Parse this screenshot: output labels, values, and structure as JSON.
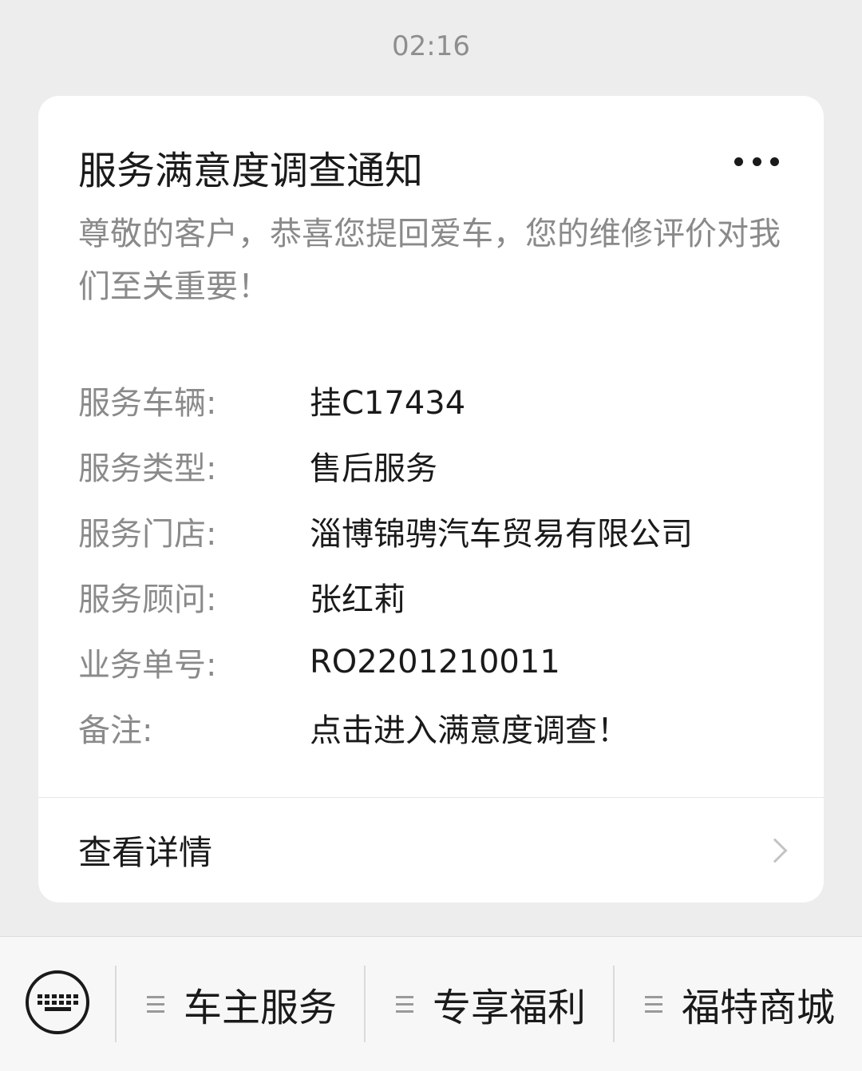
{
  "time": "02:16",
  "card": {
    "title": "服务满意度调查通知",
    "description": "尊敬的客户，恭喜您提回爱车，您的维修评价对我们至关重要！",
    "rows": [
      {
        "key": "服务车辆:",
        "value": "挂C17434"
      },
      {
        "key": "服务类型:",
        "value": "售后服务"
      },
      {
        "key": "服务门店:",
        "value": "淄博锦骋汽车贸易有限公司"
      },
      {
        "key": "服务顾问:",
        "value": "张红莉"
      },
      {
        "key": "业务单号:",
        "value": "RO2201210011"
      },
      {
        "key": "备注:",
        "value": "点击进入满意度调查！"
      }
    ],
    "detail_label": "查看详情"
  },
  "bottom_menu": {
    "items": [
      {
        "label": "车主服务"
      },
      {
        "label": "专享福利"
      },
      {
        "label": "福特商城"
      }
    ]
  },
  "icons": {
    "more": "more-dots-icon",
    "chevron": "chevron-right-icon",
    "keyboard": "keyboard-icon",
    "menu": "menu-lines-icon"
  }
}
